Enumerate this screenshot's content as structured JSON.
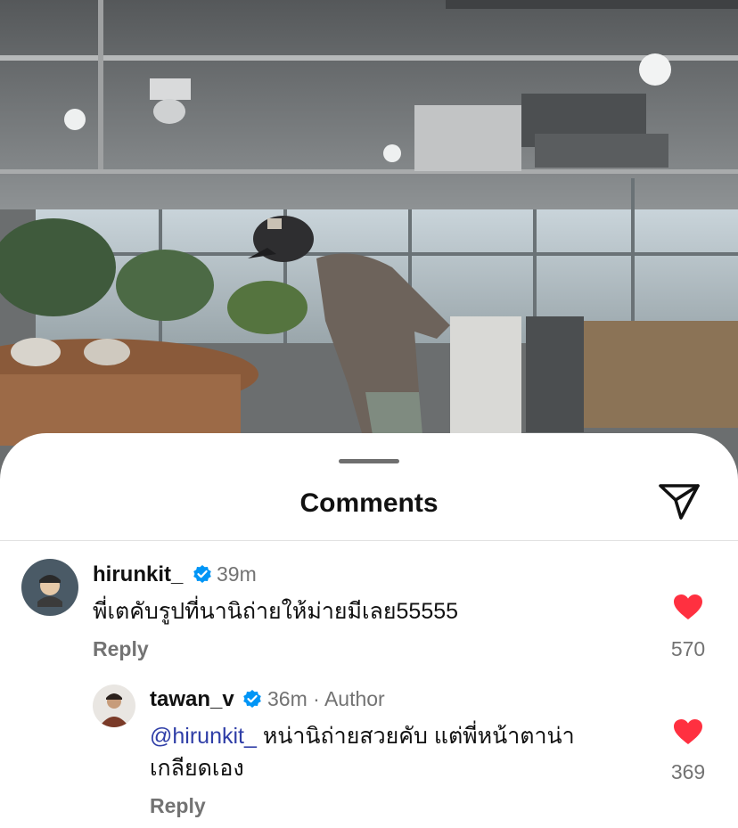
{
  "sheet": {
    "title": "Comments"
  },
  "comments": [
    {
      "username": "hirunkit_",
      "verified": true,
      "time": "39m",
      "text": "พี่เตคับรูปที่นานิถ่ายให้ม่ายมีเลย55555",
      "reply_label": "Reply",
      "likes": "570",
      "liked": true
    },
    {
      "username": "tawan_v",
      "verified": true,
      "time": "36m",
      "separator": "·",
      "role": "Author",
      "mention": "@hirunkit_",
      "text_line1": "หน่านิถ่ายสวยคับ แต่พี่หน้าตาน่า",
      "text_line2": "เกลียดเอง",
      "reply_label": "Reply",
      "likes": "369",
      "liked": true
    }
  ],
  "colors": {
    "heart": "#ff3040",
    "verified": "#0095f6",
    "mention": "#2f3ea7"
  }
}
